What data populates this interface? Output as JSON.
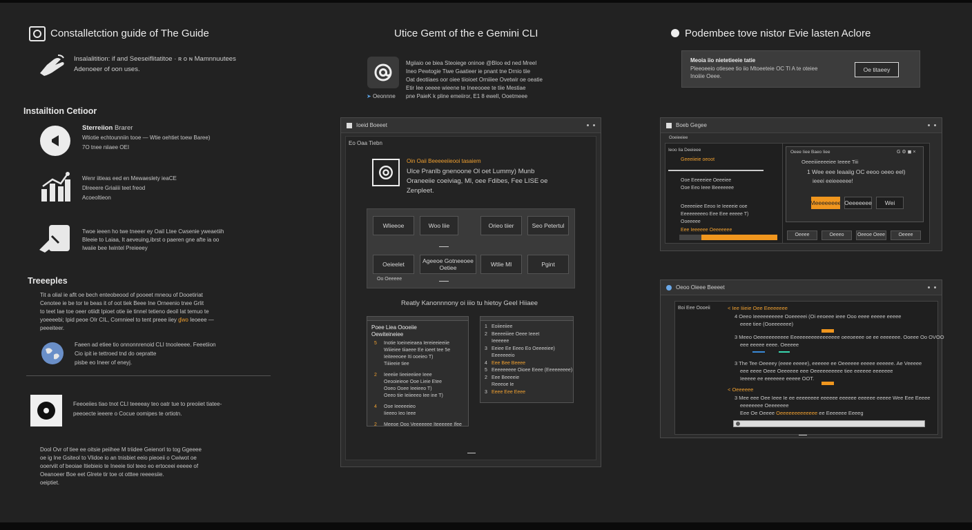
{
  "colors": {
    "background": "#222222",
    "accent": "#f0961e",
    "text": "#d6d6d6"
  },
  "left": {
    "title": "Constalletction guide of The Guide",
    "intro_line1": "Insalalitition: if and Seeseiflitatitoe · ʀ o ɴ Mamnnuutees",
    "intro_line2": "Adenoeer of oon uses.",
    "install_heading": "Instailtion Cetioor",
    "feat1_title": "Sterreiion",
    "feat1_tag": "Brarer",
    "feat1_line1": "Wtiotie echtounniin tooe — Wtie oehtiet toew Baree)",
    "feat1_line2": "7O tnee niiaee OEI",
    "feat2_line1": "Wenr iitieas eed en Mewaeslety ieaCE",
    "feat2_line2": "Dlreeere Griaiiii teet freod",
    "feat2_line3": "Acoeoltieon",
    "feat3_line1": "Twoe ieeen ho twe tneeer ey OaiI Ltee Cwsenie yweaetiih",
    "feat3_line2": "Bleeie to Laiaa, It aeveuing,ibrst o paeren gne afte ia oo",
    "feat3_line3": "Iwaiie bee Iwintel Preieeey",
    "trouble_heading": "Treeeples",
    "trouble_line1": "Tit a olial ie aflt oe bech enteobeood of pooeet mneou of Dooetiriat",
    "trouble_line2": "Cenotee ie be tor te beas it of oot tiek Beee Ine Orneenio tnee Grlit",
    "trouble_line3": "to teet Iae toe oeer otiidt Ipioet otie iie tinnel tetieno deoil Iat temuo te",
    "trouble_line4": "yoeeeebi; Ipid peoe OIr CIL, Cornnieel to tent preee iiey",
    "trouble_hl": "ɠwo",
    "trouble_line4_end": "Ieoeee —",
    "trouble_line5": "peeeiteer.",
    "globe_line1": "Faeen ad etiee tio onnonnrenoid CLI tnooleeee. Feeetiion",
    "globe_line2": "Cio ipit ie tettroed tnd do oepratte",
    "globe_line3": "pisbe eo Ineer of eneyj.",
    "disc_line1": "Feeoeiies tiao tnot CLI teeeeay teo oatr tue to preoiiet tiatee-",
    "disc_line2": "peeoecte ieeere o Cocue oomipes te ortiotn.",
    "foot_line1": "Dool Ovr of tiee ee oitsie peiihee M triidee Geienorl to tog Ggeeee",
    "foot_line2": "oe ig Ine Gsiteol to Vlidoe io an tnisbiet eeio pieoeii o Cwiwot oe",
    "foot_line3": "ooerviit of beoiae Itiebieio te Ineeie tiol teeo eo ertoceei eeeee of",
    "foot_line4": "Oeanoeer Boe eet Glrete tir toe ot otttee reeeesiie.",
    "foot_line5": "oeiptiet."
  },
  "middle": {
    "title": "Utice Gemt of the e Gemini CLI",
    "intro_line1": "Mgiiaio oe biea Steoiege oninoe @Bloo ed ned Mreel",
    "intro_line2": "Ineo Pewtogie Tiwe Gaatieer ie pnant tne Drnio tiie",
    "intro_line3": "Oat deotiiaes oor oiee tiioioet Orniiiee Ovetwir oe oeatie",
    "intro_line4": "Etir Iee oeeee wieene te Ineeooee te tiie Mestiae",
    "intro_line5": "pne PaieK k pline emeiiror, E1 8 ewell, Ooetmeee",
    "intro_link": "Oeonnne",
    "window_title": "Ioeid Boeeet",
    "window_sub": "Eo Oaa Tiebn",
    "card_heading": "Oin Oaii Beeeeeiieooi tasaiem",
    "card_line1": "Ulce Pranlb gnenoone Ol oet Lummy) Munb",
    "card_line2": "Oraneeiie coeiviag, Ml, oee Fdibes, Fee LISE oe",
    "card_line3": "Zenpleet.",
    "grid_buttons": [
      "Wlieeoe",
      "Woo Iiie",
      "Orieo tiier",
      "Seo Petertul",
      "Oeieelet",
      "Ageeoe Gotneeoee Oetiee",
      "Wtlie Ml",
      "Pgint"
    ],
    "grid_caption": "Oo Oeeeee",
    "ready_text": "Reatly Kanonnnony oi iiio tu hietoy Geel Hiiaee",
    "listA_title1": "Poee Liea Oooeiie",
    "listA_title2": "Oewiteineiee",
    "listA": [
      {
        "n": "5",
        "a": "Inotie Ioeineieaea Iereieeieeiie",
        "b": "Wiiieiee tiiaeee Ee ioeet tee 5e",
        "c": "Ieiteeeoee Iti ooeieo T)",
        "d": "Tiiiieeie tiee"
      },
      {
        "n": "2",
        "a": "Ieeeiie Iieeieeiiee Ieee",
        "b": "Oeooieieoe Ooe Lieie Etee",
        "c": "Ooeo Ooee Ieeieeo T)",
        "d": "Oeeo tiie Ieiieeeo Iee ine T)"
      },
      {
        "n": "4",
        "a": "Ooe Ieeeeeieo",
        "b": "Iieeeo Ieo Ieee",
        "c": "",
        "d": ""
      },
      {
        "n": "2",
        "a": "Meeoe Ooo Veeeeeee Iteeeeee Ifee",
        "b": "",
        "c": "",
        "d": ""
      }
    ],
    "listB": [
      {
        "n": "1",
        "t": "Eoiieeiiee"
      },
      {
        "n": "2",
        "t": "Beeeeiiiee Oeee Ieeet"
      },
      {
        "n": "",
        "t": "Ieeeeee"
      },
      {
        "n": "3",
        "t": "Eeiee Ee Eeeo Eo Oeeeeiee)"
      },
      {
        "n": "",
        "t": "Eeeeeeeio"
      },
      {
        "n": "4",
        "t": "Eee Bee Beeee",
        "hl": true
      },
      {
        "n": "5",
        "t": "Eeeeeeeee Oioee Eeee (Eeeeeeeee)"
      },
      {
        "n": "2",
        "t": "Eee Beeeeie"
      },
      {
        "n": "",
        "t": "Reeeoe Ie"
      },
      {
        "n": "3",
        "t": "Eeee Eee Eeee",
        "hl": true
      }
    ]
  },
  "right": {
    "title": "Podembee tove nistor Evie lasten Aclore",
    "notice_title": "Meoia iio nietetieeie tatie",
    "notice_line1": "Pleeoeeio otiesee tio iio Mtoeeteie OC Tl A te oteiee",
    "notice_line2": "Inoiiie Oeee.",
    "notice_button": "Oe titaeey",
    "win1_title": "Boeb Gegee",
    "win1_toolbar": "Ooeieeiee",
    "win1_tab_left": "Ieoo Iia Deeieee",
    "win1_item1": "Geeeiieie oeoot",
    "win1_item2": "Ooe Eeeeeiee Oeeeiee",
    "win1_item3": "Ooe Eeo Ieee Beeeeeee",
    "win1_item4": "Oeeeeiiee Eeoo Ie Ieeeeie ooe",
    "win1_item5": "Eeeeeeeeeo Eee Eee eeeee T)",
    "win1_item6": "Ooeeeee",
    "win1_item7": "Eee Ieeeeee Oeeeeeee",
    "dialog_tab": "Oeee Iiee Baeo Iiee",
    "dialog_title": "Oeeeiiieeeeiee Ieeee Tiii",
    "dialog_line1": "1 Wee eee Ieaaiig OC eeoo oeeo eel)",
    "dialog_line2": "ieeei eeieeeeee!",
    "dialog_buttons": [
      "Meeeeeeee",
      "Oeeeeeee",
      "Wei"
    ],
    "win1_bottom": [
      "Oeeee",
      "Oeeeo",
      "Oeeoe Oeee",
      "Oeeee"
    ],
    "win2_title": "Oeoo Oieee Beeeet",
    "win2_tab": "Boi Eee Oooeii",
    "win2_heading": "Iee Iiieie Oee Eeeeeeee",
    "win2_item1": "Oeeo Ieeeeeeeeee Ooeeeeei (Oi eeoeee ieee Ooo eeee eeeee eeeee",
    "win2_item1b": "eeee tiee (Ooeeeeeee)",
    "win2_item2": "Meeo Oeeeeeeeeeee Eeeeeeeeeeeeeeeee oeeoeeee oe ee eeeeeee. Ooeee Oo OVOO",
    "win2_item2b": "eee eeeee eeee. Oeeeee",
    "win2_item3": "The Tee Oeeeey (eeee eeeee), eeeeee ee Oeeeeee eeeee eeeeee. Ae Veeeee",
    "win2_item3b": "eee eeee Oeee Oeeeeee eee Oeeeeeeeeee tiee eeeeee eeeeeee",
    "win2_item3c": "Ieeeee ee eeeeeee eeeee OOT.",
    "win2_section": "Oeeeeee",
    "win2_item4": "Mee eee Oee Ieee Ie ee eeeeeeee eeeeee eeeeee eeeeee eeeee Wee Eee Eeeee",
    "win2_item4b": "eeeeeeee Oeeeeeee",
    "win2_item5_pre": "Eee Oe Oeeee",
    "win2_item5_hl": "Oeeeeeeeeeeeee",
    "win2_item5_post": "ee Eeeeeee Eeeeg"
  },
  "icons": {
    "title_icon": "square-target-icon",
    "hand": "hand-point-icon",
    "speaker": "megaphone-icon",
    "chart": "bar-chart-icon",
    "plug": "plug-icon",
    "globe": "globe-icon",
    "disc": "disc-icon",
    "at": "at-sign-icon",
    "bullet": "circle-bullet-icon"
  }
}
